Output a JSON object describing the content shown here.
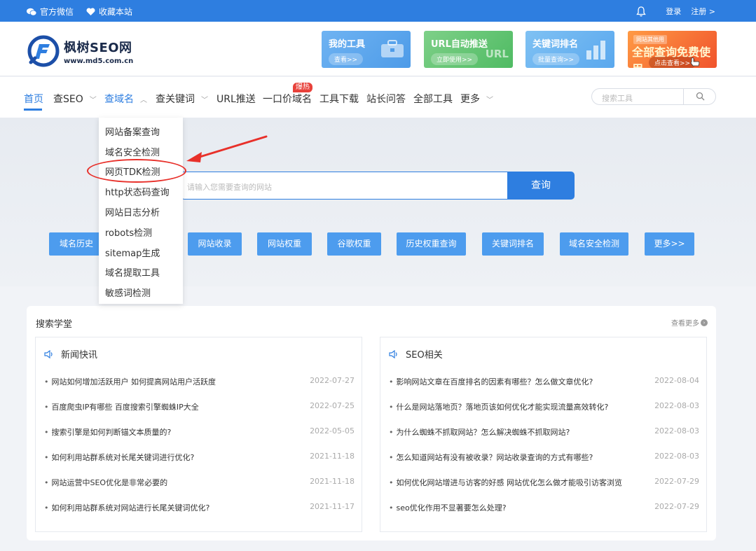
{
  "topbar": {
    "wechat_label": "官方微信",
    "favorite_label": "收藏本站",
    "login_label": "登录",
    "register_label": "注册 >"
  },
  "logo": {
    "name": "枫树SEO网",
    "url": "www.md5.com.cn"
  },
  "banners": [
    {
      "title": "我的工具",
      "button": "查看>>"
    },
    {
      "title": "URL自动推送",
      "button": "立即使用>>",
      "badge": "URL"
    },
    {
      "title": "关键词排名",
      "button": "批量查询>>"
    },
    {
      "title": "全部查询免费使用",
      "small": "网站其他用",
      "button": "点击查看>>"
    }
  ],
  "nav": {
    "items": [
      "首页",
      "查SEO",
      "查域名",
      "查关键词",
      "URL推送",
      "一口价域名",
      "工具下载",
      "站长问答",
      "全部工具",
      "更多"
    ],
    "hot_badge": "爆热",
    "search_placeholder": "搜索工具"
  },
  "dropdown": {
    "items": [
      "网站备案查询",
      "域名安全检测",
      "网页TDK检测",
      "http状态码查询",
      "网站日志分析",
      "robots检测",
      "sitemap生成",
      "域名提取工具",
      "敏感词检测"
    ],
    "highlighted": "网页TDK检测"
  },
  "hero": {
    "input_placeholder": "请输入您需要查询的网站",
    "query_button": "查询",
    "quick_buttons": [
      "域名历史",
      "网站收录",
      "网站权重",
      "谷歌权重",
      "历史权重查询",
      "关键词排名",
      "域名安全检测",
      "更多>>"
    ]
  },
  "content": {
    "title": "搜索学堂",
    "more": "查看更多",
    "news": {
      "title": "新闻快讯",
      "rows": [
        {
          "text": "网站如何增加活跃用户 如何提高网站用户活跃度",
          "date": "2022-07-27"
        },
        {
          "text": "百度爬虫IP有哪些 百度搜索引擎蜘蛛IP大全",
          "date": "2022-07-25"
        },
        {
          "text": "搜索引擎是如何判断锚文本质量的?",
          "date": "2022-05-05"
        },
        {
          "text": "如何利用站群系统对长尾关键词进行优化?",
          "date": "2021-11-18"
        },
        {
          "text": "网站运营中SEO优化是非常必要的",
          "date": "2021-11-18"
        },
        {
          "text": "如何利用站群系统对网站进行长尾关键词优化?",
          "date": "2021-11-17"
        }
      ]
    },
    "seo": {
      "title": "SEO相关",
      "rows": [
        {
          "text": "影响网站文章在百度排名的因素有哪些？怎么做文章优化?",
          "date": "2022-08-04"
        },
        {
          "text": "什么是网站落地页？落地页该如何优化才能实现流量高效转化?",
          "date": "2022-08-03"
        },
        {
          "text": "为什么蜘蛛不抓取网站？怎么解决蜘蛛不抓取网站?",
          "date": "2022-08-03"
        },
        {
          "text": "怎么知道网站有没有被收录？网站收录查询的方式有哪些?",
          "date": "2022-08-03"
        },
        {
          "text": "如何优化网站增进与访客的好感 网站优化怎么做才能吸引访客浏览",
          "date": "2022-07-29"
        },
        {
          "text": "seo优化作用不显著要怎么处理?",
          "date": "2022-07-29"
        }
      ]
    }
  },
  "colors": {
    "brand_blue": "#2e7ee0",
    "quick_button_blue": "#4d9cee",
    "highlight_red": "#e8302a"
  }
}
